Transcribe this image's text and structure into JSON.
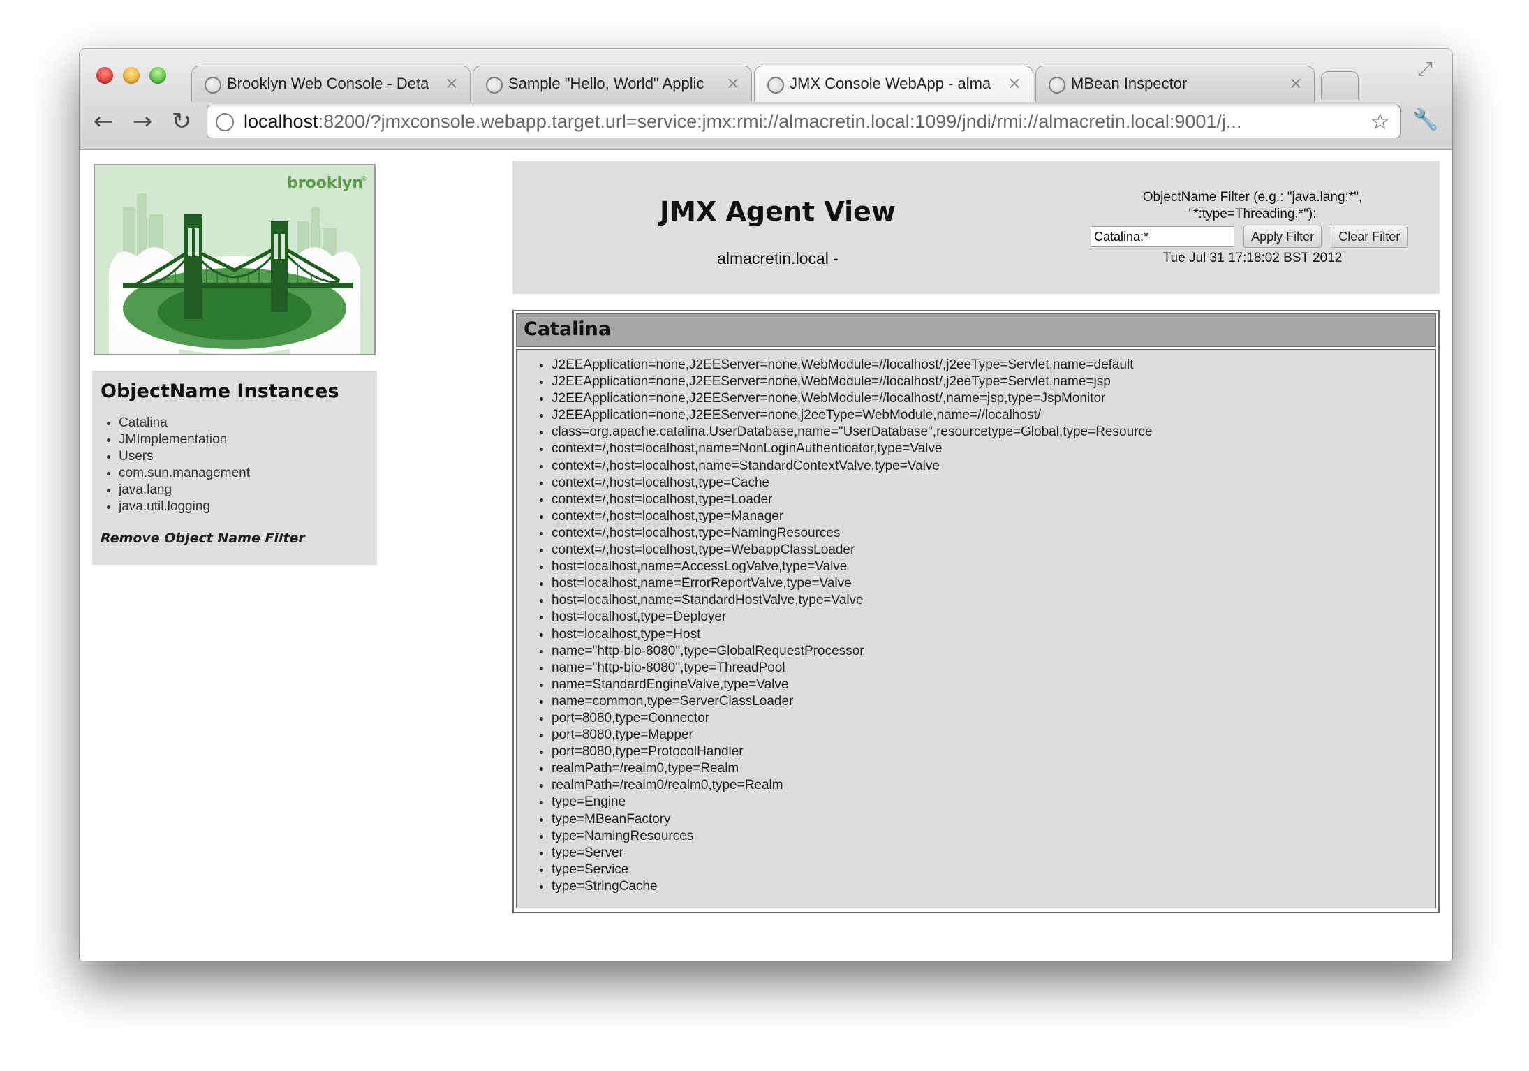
{
  "browser": {
    "tabs": [
      {
        "title": "Brooklyn Web Console - Deta",
        "close": "×",
        "active": false
      },
      {
        "title": "Sample \"Hello, World\" Applic",
        "close": "×",
        "active": false
      },
      {
        "title": "JMX Console WebApp - alma",
        "close": "×",
        "active": true
      },
      {
        "title": "MBean Inspector",
        "close": "×",
        "active": false
      }
    ],
    "nav": {
      "back": "←",
      "forward": "→",
      "reload": "↻",
      "star": "☆",
      "wrench": "🔧",
      "resize": "⤢"
    },
    "url_host": "localhost",
    "url_rest": ":8200/?jmxconsole.webapp.target.url=service:jmx:rmi://almacretin.local:1099/jndi/rmi://almacretin.local:9001/j..."
  },
  "logo": {
    "brand": "brooklyn",
    "mark": "®"
  },
  "sidebar": {
    "title": "ObjectName Instances",
    "items": [
      "Catalina",
      "JMImplementation",
      "Users",
      "com.sun.management",
      "java.lang",
      "java.util.logging"
    ],
    "remove_link": "Remove Object Name Filter"
  },
  "header": {
    "title": "JMX Agent View",
    "host": "almacretin.local -",
    "filter_hint_line1": "ObjectName Filter (e.g.: \"java.lang:*\",",
    "filter_hint_line2": "\"*:type=Threading,*\"):",
    "filter_value": "Catalina:*",
    "apply_label": "Apply Filter",
    "clear_label": "Clear Filter",
    "date": "Tue Jul 31 17:18:02 BST 2012"
  },
  "domain": {
    "name": "Catalina",
    "mbeans": [
      "J2EEApplication=none,J2EEServer=none,WebModule=//localhost/,j2eeType=Servlet,name=default",
      "J2EEApplication=none,J2EEServer=none,WebModule=//localhost/,j2eeType=Servlet,name=jsp",
      "J2EEApplication=none,J2EEServer=none,WebModule=//localhost/,name=jsp,type=JspMonitor",
      "J2EEApplication=none,J2EEServer=none,j2eeType=WebModule,name=//localhost/",
      "class=org.apache.catalina.UserDatabase,name=\"UserDatabase\",resourcetype=Global,type=Resource",
      "context=/,host=localhost,name=NonLoginAuthenticator,type=Valve",
      "context=/,host=localhost,name=StandardContextValve,type=Valve",
      "context=/,host=localhost,type=Cache",
      "context=/,host=localhost,type=Loader",
      "context=/,host=localhost,type=Manager",
      "context=/,host=localhost,type=NamingResources",
      "context=/,host=localhost,type=WebappClassLoader",
      "host=localhost,name=AccessLogValve,type=Valve",
      "host=localhost,name=ErrorReportValve,type=Valve",
      "host=localhost,name=StandardHostValve,type=Valve",
      "host=localhost,type=Deployer",
      "host=localhost,type=Host",
      "name=\"http-bio-8080\",type=GlobalRequestProcessor",
      "name=\"http-bio-8080\",type=ThreadPool",
      "name=StandardEngineValve,type=Valve",
      "name=common,type=ServerClassLoader",
      "port=8080,type=Connector",
      "port=8080,type=Mapper",
      "port=8080,type=ProtocolHandler",
      "realmPath=/realm0,type=Realm",
      "realmPath=/realm0/realm0,type=Realm",
      "type=Engine",
      "type=MBeanFactory",
      "type=NamingResources",
      "type=Server",
      "type=Service",
      "type=StringCache"
    ]
  }
}
